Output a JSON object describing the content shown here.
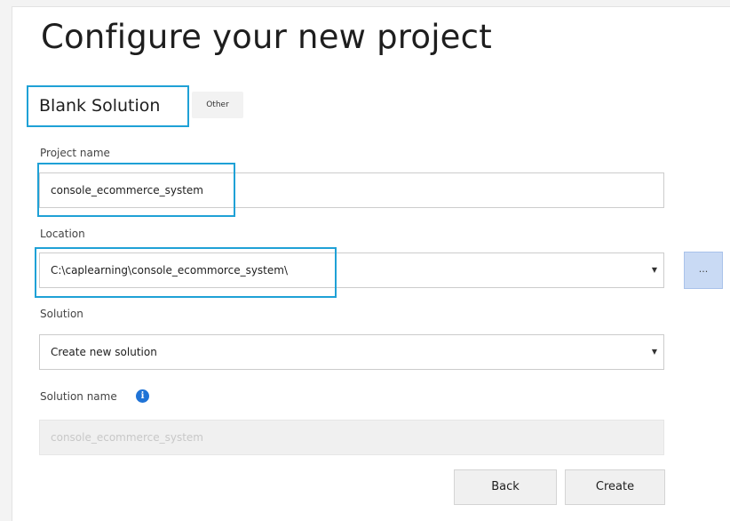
{
  "page": {
    "title": "Configure your new project"
  },
  "template": {
    "name": "Blank Solution",
    "tag": "Other"
  },
  "project_name": {
    "label": "Project name",
    "value": "console_ecommerce_system"
  },
  "location": {
    "label": "Location",
    "value": "C:\\caplearning\\console_ecommorce_system\\",
    "browse_label": "..."
  },
  "solution": {
    "label": "Solution",
    "value": "Create new solution"
  },
  "solution_name": {
    "label": "Solution name",
    "value": "console_ecommerce_system",
    "info_glyph": "i"
  },
  "buttons": {
    "back": "Back",
    "create": "Create"
  },
  "colors": {
    "highlight": "#1fa1d6",
    "info": "#1f73d6",
    "browse": "#c9daf4"
  },
  "icons": {
    "dropdown": "chevron-down-icon",
    "info": "info-icon"
  }
}
